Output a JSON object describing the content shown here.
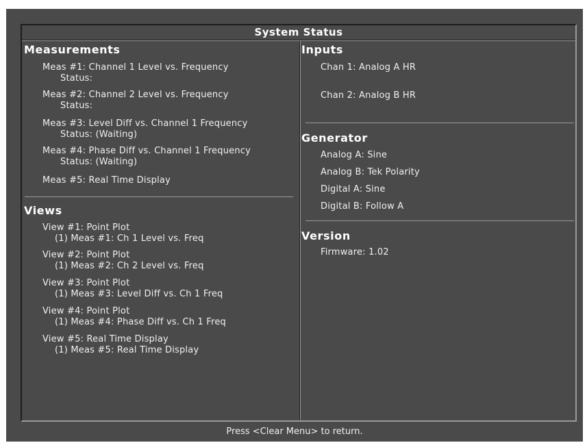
{
  "title": "System Status",
  "measurements": {
    "heading": "Measurements",
    "items": [
      {
        "label": "Meas #1:  Channel 1 Level vs. Frequency",
        "status": "Status:"
      },
      {
        "label": "Meas #2:  Channel 2 Level vs. Frequency",
        "status": "Status:"
      },
      {
        "label": "Meas #3:  Level Diff vs. Channel 1 Frequency",
        "status": "Status:  (Waiting)"
      },
      {
        "label": "Meas #4:  Phase Diff vs. Channel 1 Frequency",
        "status": "Status:  (Waiting)"
      },
      {
        "label": "Meas #5:  Real Time Display"
      }
    ]
  },
  "views": {
    "heading": "Views",
    "items": [
      {
        "label": "View #1: Point Plot",
        "detail": "(1) Meas #1:  Ch 1 Level vs. Freq"
      },
      {
        "label": "View #2: Point Plot",
        "detail": "(1) Meas #2:  Ch 2 Level vs. Freq"
      },
      {
        "label": "View #3: Point Plot",
        "detail": "(1) Meas #3:  Level Diff vs. Ch 1 Freq"
      },
      {
        "label": "View #4: Point Plot",
        "detail": "(1) Meas #4:  Phase Diff vs. Ch 1 Freq"
      },
      {
        "label": "View #5: Real Time Display",
        "detail": "(1) Meas #5:  Real Time Display"
      }
    ]
  },
  "inputs": {
    "heading": "Inputs",
    "items": [
      "Chan 1:  Analog A HR",
      "Chan 2:  Analog B HR"
    ]
  },
  "generator": {
    "heading": "Generator",
    "items": [
      "Analog A:  Sine",
      "Analog B:  Tek Polarity",
      "Digital A:  Sine",
      "Digital B:  Follow A"
    ]
  },
  "version": {
    "heading": "Version",
    "items": [
      "Firmware:  1.02"
    ]
  },
  "footer": "Press <Clear Menu> to return."
}
